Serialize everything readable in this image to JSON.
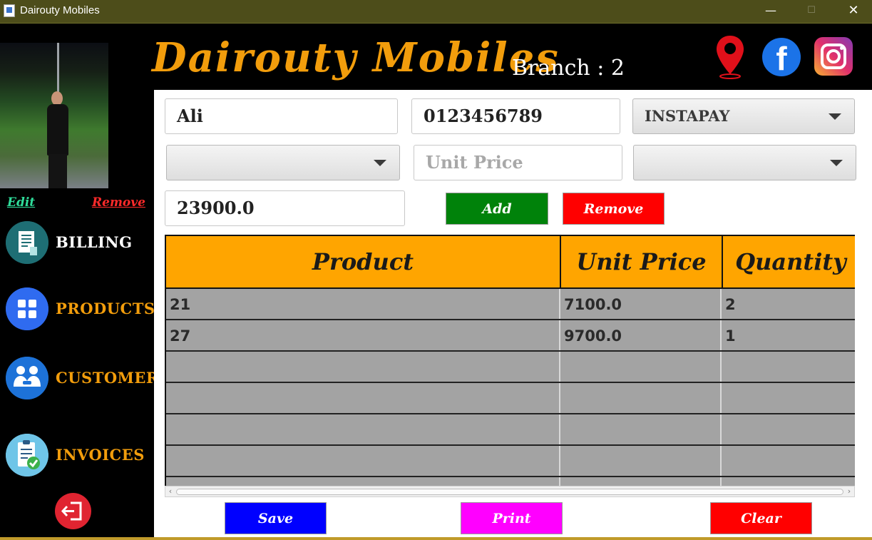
{
  "window": {
    "title": "Dairouty Mobiles",
    "minimize_glyph": "—",
    "maximize_glyph": "☐",
    "close_glyph": "✕"
  },
  "header": {
    "brand": "Dairouty Mobiles",
    "branch": "Branch : 2",
    "icons": [
      "location-icon",
      "facebook-icon",
      "instagram-icon"
    ],
    "facebook_glyph": "f"
  },
  "sidebar": {
    "edit_label": "Edit",
    "remove_label": "Remove",
    "nav": [
      {
        "label": "BILLING",
        "icon": "billing-icon"
      },
      {
        "label": "PRODUCTS",
        "icon": "products-icon"
      },
      {
        "label": "CUSTOMERS",
        "icon": "customers-icon"
      },
      {
        "label": "INVOICES",
        "icon": "invoices-icon"
      }
    ],
    "logout_icon": "logout-icon"
  },
  "form": {
    "customer_name": "Ali",
    "phone": "0123456789",
    "payment_method": "INSTAPAY",
    "product_selected": "",
    "unit_price_placeholder": "Unit Price",
    "quantity_selected": "",
    "total": "23900.0",
    "add_label": "Add",
    "remove_label": "Remove"
  },
  "table": {
    "columns": [
      "Product",
      "Unit Price",
      "Quantity"
    ],
    "rows": [
      [
        "21",
        "7100.0",
        "2"
      ],
      [
        "27",
        "9700.0",
        "1"
      ],
      [
        "",
        "",
        ""
      ],
      [
        "",
        "",
        ""
      ],
      [
        "",
        "",
        ""
      ],
      [
        "",
        "",
        ""
      ],
      [
        "",
        "",
        ""
      ]
    ]
  },
  "footer": {
    "save_label": "Save",
    "print_label": "Print",
    "clear_label": "Clear"
  },
  "colors": {
    "brand": "#f29d0c",
    "header_table": "#ffa500",
    "add": "#00820a",
    "remove": "#ff0000",
    "save": "#0000ff",
    "print": "#ff00ff",
    "clear": "#ff0000"
  }
}
